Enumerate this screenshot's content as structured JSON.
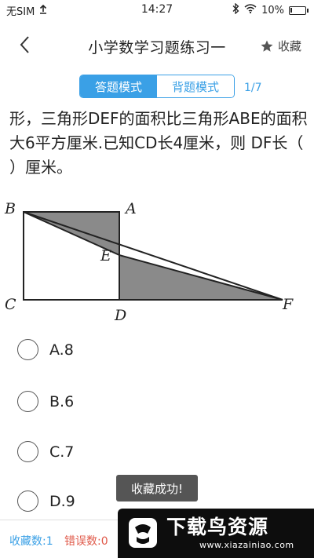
{
  "status_bar": {
    "carrier": "无SIM",
    "time": "14:27",
    "battery": "10%",
    "battery_level": 0.1
  },
  "header": {
    "title": "小学数学习题练习一",
    "favorite_label": "收藏"
  },
  "mode": {
    "answer_mode": "答题模式",
    "recite_mode": "背题模式",
    "active": "answer_mode",
    "page_indicator": "1/7"
  },
  "question": {
    "text": "形，三角形DEF的面积比三角形ABE的面积大6平方厘米.已知CD长4厘米，则 DF长（ ）厘米。"
  },
  "figure": {
    "labels": [
      "B",
      "A",
      "E",
      "C",
      "D",
      "F"
    ]
  },
  "options": [
    {
      "label": "A.8"
    },
    {
      "label": "B.6"
    },
    {
      "label": "C.7"
    },
    {
      "label": "D.9"
    }
  ],
  "toast": "收藏成功!",
  "footer": {
    "favorites": "收藏数:1",
    "errors": "错误数:0"
  },
  "watermark": {
    "brand": "下载鸟资源",
    "url": "www.xiazainiao.com"
  },
  "colors": {
    "accent": "#3aa0e6",
    "error": "#e05a4a",
    "toast_bg": "#555555",
    "shade": "#8a8a8a"
  }
}
